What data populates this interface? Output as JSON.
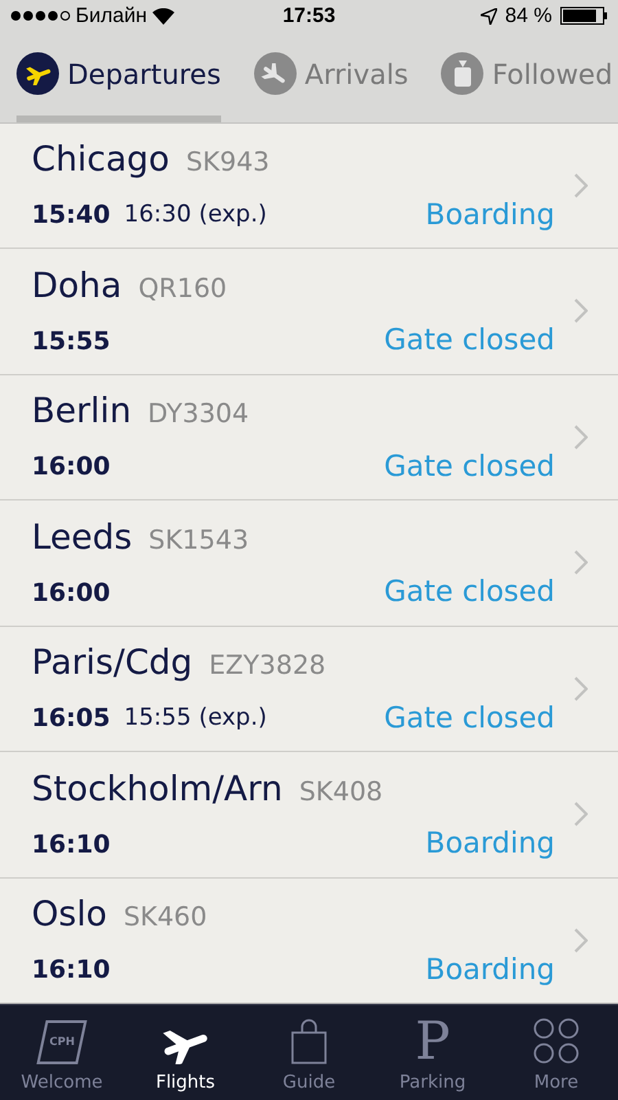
{
  "status_bar": {
    "carrier": "Билайн",
    "time": "17:53",
    "battery": "84 %"
  },
  "tabs": [
    {
      "label": "Departures",
      "kind": "departures",
      "selected": true
    },
    {
      "label": "Arrivals",
      "kind": "arrivals",
      "selected": false
    },
    {
      "label": "Followed",
      "kind": "followed",
      "selected": false
    }
  ],
  "flights": [
    {
      "city": "Chicago",
      "code": "SK943",
      "time": "15:40",
      "expected": "16:30 (exp.)",
      "status": "Boarding"
    },
    {
      "city": "Doha",
      "code": "QR160",
      "time": "15:55",
      "status": "Gate closed"
    },
    {
      "city": "Berlin",
      "code": "DY3304",
      "time": "16:00",
      "status": "Gate closed"
    },
    {
      "city": "Leeds",
      "code": "SK1543",
      "time": "16:00",
      "status": "Gate closed"
    },
    {
      "city": "Paris/Cdg",
      "code": "EZY3828",
      "time": "16:05",
      "expected": "15:55 (exp.)",
      "status": "Gate closed"
    },
    {
      "city": "Stockholm/Arn",
      "code": "SK408",
      "time": "16:10",
      "status": "Boarding"
    },
    {
      "city": "Oslo",
      "code": "SK460",
      "time": "16:10",
      "status": "Boarding"
    }
  ],
  "tab_bar": [
    {
      "label": "Welcome",
      "kind": "welcome",
      "icon_text": "CPH",
      "selected": false
    },
    {
      "label": "Flights",
      "kind": "flights",
      "selected": true
    },
    {
      "label": "Guide",
      "kind": "guide",
      "selected": false
    },
    {
      "label": "Parking",
      "kind": "parking",
      "icon_text": "P",
      "selected": false
    },
    {
      "label": "More",
      "kind": "more",
      "selected": false
    }
  ]
}
